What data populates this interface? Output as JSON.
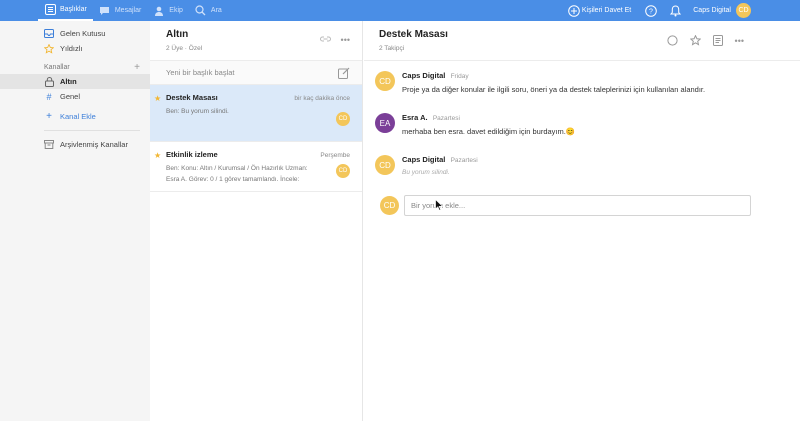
{
  "topbar": {
    "nav": [
      {
        "label": "Başlıklar",
        "icon": "topics-icon"
      },
      {
        "label": "Mesajlar",
        "icon": "messages-icon"
      },
      {
        "label": "Ekip",
        "icon": "team-icon"
      },
      {
        "label": "Ara",
        "icon": "search-icon"
      }
    ],
    "invite_label": "Kişileri Davet Et",
    "user_name": "Caps Digital",
    "user_initials": "CD",
    "accent": "#4a8ee6"
  },
  "sidebar": {
    "inbox": "Gelen Kutusu",
    "starred": "Yıldızlı",
    "channels_header": "Kanallar",
    "channels": [
      {
        "label": "Altın",
        "icon": "lock-icon"
      },
      {
        "label": "Genel",
        "icon": "hash-icon"
      }
    ],
    "add_channel": "Kanal Ekle",
    "archived": "Arşivlenmiş Kanallar"
  },
  "channel": {
    "title": "Altın",
    "members": "2 Üye",
    "privacy": "Özel",
    "new_topic_placeholder": "Yeni bir başlık başlat",
    "topics": [
      {
        "title": "Destek Masası",
        "time": "bir kaç dakika önce",
        "preview": "Ben: Bu yorum silindi.",
        "avatar": "CD"
      },
      {
        "title": "Etkinlik izleme",
        "time": "Perşembe",
        "preview": "Ben: Konu: Altın / Kurumsal / Ön Hazırlık Uzman: Esra A. Görev: 0 / 1 görev tamamlandı. İncele:",
        "avatar": "CD"
      }
    ]
  },
  "topic": {
    "title": "Destek Masası",
    "followers": "2 Takipçi",
    "messages": [
      {
        "author": "Caps Digital",
        "when": "Friday",
        "text": "Proje ya da diğer konular ile ilgili soru, öneri ya da destek taleplerinizi için kullanılan alandır.",
        "initials": "CD",
        "deleted": false
      },
      {
        "author": "Esra A.",
        "when": "Pazartesi",
        "text": "merhaba ben esra. davet edildiğim için burdayım.😊",
        "initials": "EA",
        "deleted": false
      },
      {
        "author": "Caps Digital",
        "when": "Pazartesi",
        "text": "Bu yorum silindi.",
        "initials": "CD",
        "deleted": true
      }
    ],
    "reply_placeholder": "Bir yorum ekle...",
    "reply_avatar": "CD"
  }
}
